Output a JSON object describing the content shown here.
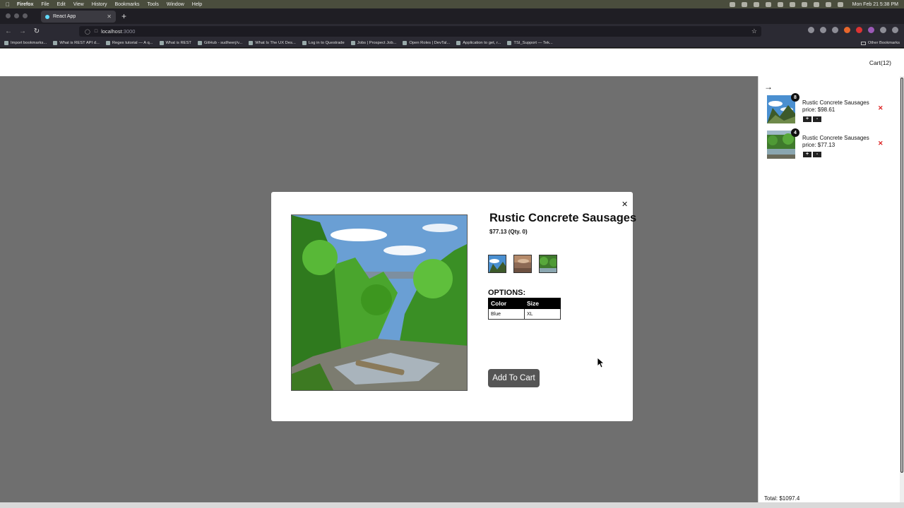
{
  "menubar": {
    "app_name": "Firefox",
    "menus": [
      "File",
      "Edit",
      "View",
      "History",
      "Bookmarks",
      "Tools",
      "Window",
      "Help"
    ],
    "clock": "Mon Feb 21  5:38 PM"
  },
  "browser": {
    "tab_title": "React App",
    "url_host": "localhost",
    "url_port": ":3000",
    "bookmarks": [
      "Import bookmarks...",
      "What is REST API d...",
      "Regex tutorial — A q...",
      "What is REST",
      "GitHub - sudheerj/v...",
      "What Is The UX Des...",
      "Log in to Questrade",
      "Jobs | Prospect Job...",
      "Open Roles | DevTal...",
      "Application to get, r...",
      "TSI_Support — Tek..."
    ],
    "other_bookmarks": "Other Bookmarks"
  },
  "header": {
    "cart_label": "Cart(12)"
  },
  "modal": {
    "title": "Rustic Concrete Sausages",
    "price_line": "$77.13 (Qty. 0)",
    "options_label": "OPTIONS:",
    "options_headers": [
      "Color",
      "Size"
    ],
    "options_row": [
      "Blue",
      "XL"
    ],
    "add_to_cart": "Add To Cart"
  },
  "cart": {
    "items": [
      {
        "name": "Rustic Concrete Sausages",
        "price": "price: $98.61",
        "qty": "8"
      },
      {
        "name": "Rustic Concrete Sausages",
        "price": "price: $77.13",
        "qty": "4"
      }
    ],
    "plus_label": "+",
    "minus_label": "-",
    "remove_glyph": "✕",
    "total": "Total: $1097.4"
  },
  "icons": {
    "close": "✕",
    "arrow_right": "→",
    "star": "☆"
  }
}
